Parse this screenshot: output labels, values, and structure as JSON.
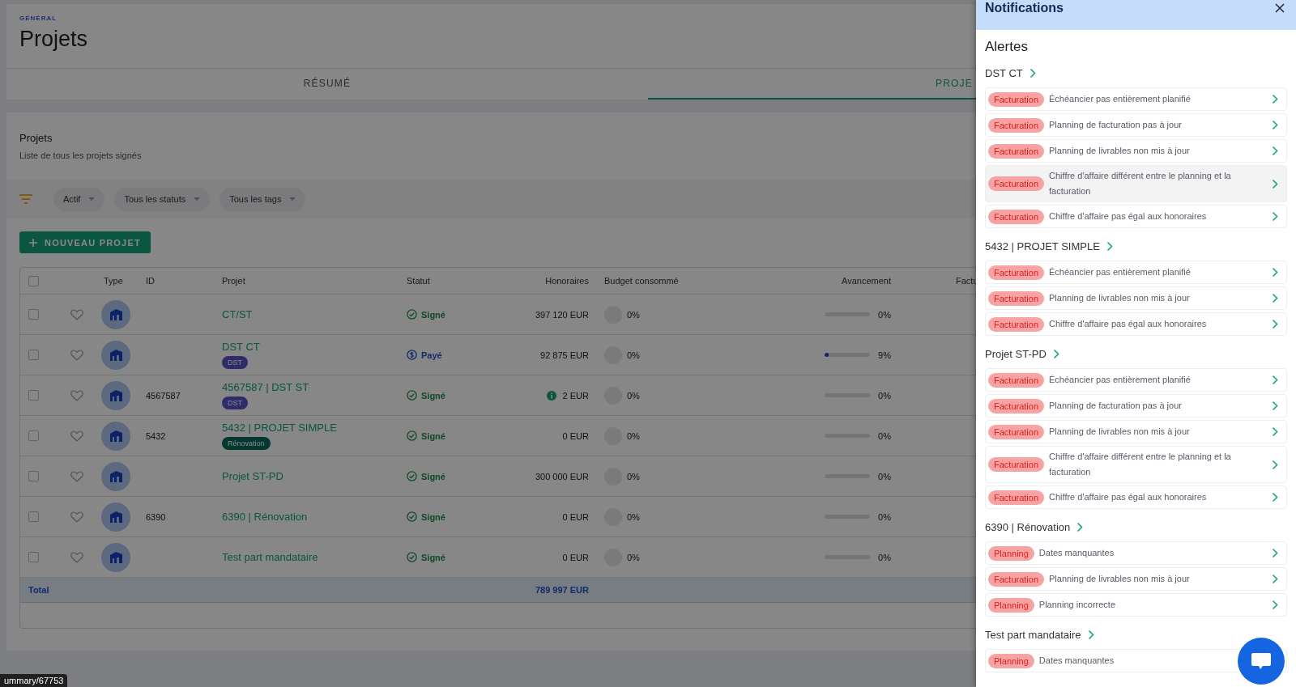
{
  "header": {
    "breadcrumb": "GÉNÉRAL",
    "title": "Projets"
  },
  "tabs": [
    {
      "label": "RÉSUMÉ",
      "selected": false
    },
    {
      "label": "PROJE",
      "selected": true
    }
  ],
  "card": {
    "title": "Projets",
    "subtitle": "Liste de tous les projets signés"
  },
  "filters": [
    "Actif",
    "Tous les statuts",
    "Tous les tags"
  ],
  "new_button": "NOUVEAU PROJET",
  "table": {
    "columns": [
      "Type",
      "ID",
      "Projet",
      "Statut",
      "Honoraires",
      "Budget consommé",
      "Avancement",
      "Factu"
    ],
    "all_checked": false,
    "rows": [
      {
        "checked": false,
        "favorite": false,
        "project": "CT/ST",
        "status": {
          "label": "Signé",
          "kind": "signed"
        },
        "fees": "397 120 EUR",
        "fee_alert": false,
        "budget": "0%",
        "progress": {
          "level": 0,
          "reading": "0%"
        }
      },
      {
        "checked": false,
        "favorite": false,
        "project": "DST CT",
        "tag": {
          "label": "DST",
          "kind": "dst"
        },
        "status": {
          "label": "Payé",
          "kind": "paid"
        },
        "fees": "92 875 EUR",
        "fee_alert": false,
        "budget": "0%",
        "progress": {
          "level": 0.09,
          "reading": "9%"
        }
      },
      {
        "checked": false,
        "favorite": false,
        "id": "4567587",
        "project": "4567587 | DST ST",
        "tag": {
          "label": "DST",
          "kind": "dst"
        },
        "status": {
          "label": "Signé",
          "kind": "signed"
        },
        "fees": "2 EUR",
        "fee_alert": true,
        "budget": "0%",
        "progress": {
          "level": 0,
          "reading": "0%"
        }
      },
      {
        "checked": false,
        "favorite": false,
        "id": "5432",
        "project": "5432 | PROJET SIMPLE",
        "tag": {
          "label": "Rénovation",
          "kind": "renovation"
        },
        "status": {
          "label": "Signé",
          "kind": "signed"
        },
        "fees": "0 EUR",
        "fee_alert": false,
        "budget": "0%",
        "progress": {
          "level": 0,
          "reading": "0%"
        }
      },
      {
        "checked": false,
        "favorite": false,
        "project": "Projet ST-PD",
        "status": {
          "label": "Signé",
          "kind": "signed"
        },
        "fees": "300 000 EUR",
        "fee_alert": false,
        "budget": "0%",
        "progress": {
          "level": 0,
          "reading": "0%"
        }
      },
      {
        "checked": false,
        "favorite": false,
        "id": "6390",
        "project": "6390 | Rénovation",
        "status": {
          "label": "Signé",
          "kind": "signed"
        },
        "fees": "0 EUR",
        "fee_alert": false,
        "budget": "0%",
        "progress": {
          "level": 0,
          "reading": "0%"
        }
      },
      {
        "checked": false,
        "favorite": false,
        "project": "Test part mandataire",
        "status": {
          "label": "Signé",
          "kind": "signed"
        },
        "fees": "0 EUR",
        "fee_alert": false,
        "budget": "0%",
        "progress": {
          "level": 0,
          "reading": "0%"
        }
      }
    ],
    "total": {
      "label": "Total",
      "fees": "789 997 EUR"
    }
  },
  "drawer": {
    "title": "Notifications",
    "section": "Alertes",
    "groups": [
      {
        "project": "DST CT",
        "alerts": [
          {
            "category": "Facturation",
            "message": "Échéancier pas entièrement planifié",
            "highlighted": false
          },
          {
            "category": "Facturation",
            "message": "Planning de facturation pas à jour",
            "highlighted": false
          },
          {
            "category": "Facturation",
            "message": "Planning de livrables non mis à jour",
            "highlighted": false
          },
          {
            "category": "Facturation",
            "message": "Chiffre d'affaire différent entre le planning et la facturation",
            "highlighted": true
          },
          {
            "category": "Facturation",
            "message": "Chiffre d'affaire pas égal aux honoraires",
            "highlighted": false
          }
        ]
      },
      {
        "project": "5432 | PROJET SIMPLE",
        "alerts": [
          {
            "category": "Facturation",
            "message": "Échéancier pas entièrement planifié",
            "highlighted": false
          },
          {
            "category": "Facturation",
            "message": "Planning de livrables non mis à jour",
            "highlighted": false
          },
          {
            "category": "Facturation",
            "message": "Chiffre d'affaire pas égal aux honoraires",
            "highlighted": false
          }
        ]
      },
      {
        "project": "Projet ST-PD",
        "alerts": [
          {
            "category": "Facturation",
            "message": "Échéancier pas entièrement planifié",
            "highlighted": false
          },
          {
            "category": "Facturation",
            "message": "Planning de facturation pas à jour",
            "highlighted": false
          },
          {
            "category": "Facturation",
            "message": "Planning de livrables non mis à jour",
            "highlighted": false
          },
          {
            "category": "Facturation",
            "message": "Chiffre d'affaire différent entre le planning et la facturation",
            "highlighted": false
          },
          {
            "category": "Facturation",
            "message": "Chiffre d'affaire pas égal aux honoraires",
            "highlighted": false
          }
        ]
      },
      {
        "project": "6390 | Rénovation",
        "alerts": [
          {
            "category": "Planning",
            "message": "Dates manquantes",
            "highlighted": false
          },
          {
            "category": "Facturation",
            "message": "Planning de livrables non mis à jour",
            "highlighted": false
          },
          {
            "category": "Planning",
            "message": "Planning incorrecte",
            "highlighted": false
          }
        ]
      },
      {
        "project": "Test part mandataire",
        "alerts": [
          {
            "category": "Planning",
            "message": "Dates manquantes",
            "highlighted": false,
            "covered": true
          }
        ]
      }
    ]
  },
  "status_url": "ummary/67753"
}
